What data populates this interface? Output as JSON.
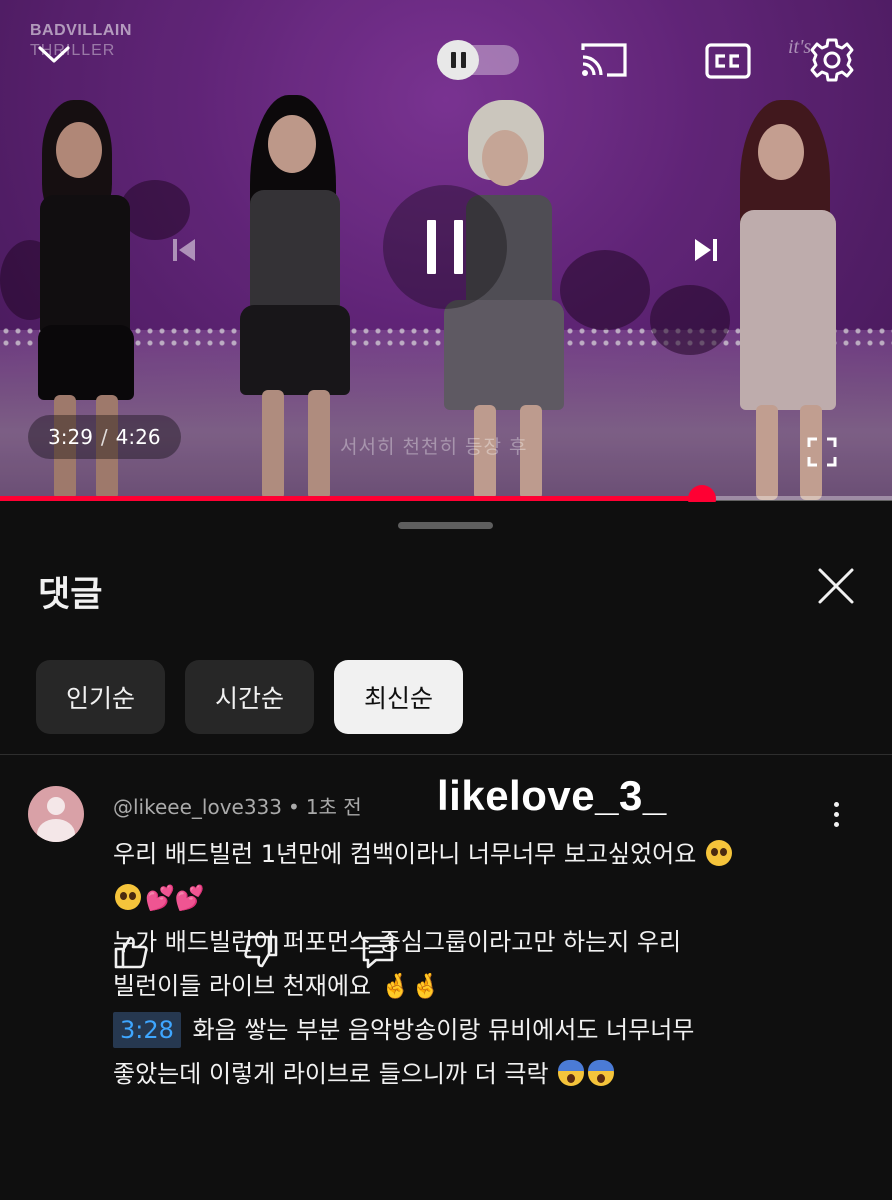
{
  "player": {
    "brand": "BADVILLAIN",
    "brand_sub": "THRILLER",
    "watermark": "it's",
    "current_time": "3:29",
    "separator": "/",
    "duration": "4:26",
    "subtitle": "서서히 천천히 등장 후",
    "progress_fraction": 0.787
  },
  "comments_panel": {
    "title": "댓글",
    "sort_chips": [
      {
        "label": "인기순",
        "active": false
      },
      {
        "label": "시간순",
        "active": false
      },
      {
        "label": "최신순",
        "active": true
      }
    ]
  },
  "comment": {
    "author": "@likeee_love333",
    "meta_dot": "•",
    "time_ago": "1초 전",
    "overlay_tag": "likelove_3_",
    "lines": {
      "l1": "우리 배드빌런 1년만에 컴백이라니 너무너무 보고싶었어요",
      "l3": "누가 배드빌런이 퍼포먼스 중심그룹이라고만 하는지 우리",
      "l4": "빌런이들 라이브 천재에요",
      "l5_timestamp": "3:28",
      "l5": "화음 쌓는 부분 음악방송이랑 뮤비에서도 너무너무",
      "l6": "좋았는데 이렇게 라이브로 들으니까 더 극락"
    },
    "emoji": {
      "hearts": "💕💕",
      "fingers": "🤞🤞"
    }
  },
  "icons": {
    "collapse": "chevron-down-icon",
    "cast": "cast-icon",
    "cc": "closed-captions-icon",
    "settings": "gear-icon",
    "fullscreen": "fullscreen-icon",
    "close": "close-icon",
    "more": "more-vert-icon",
    "like": "thumbs-up-icon",
    "dislike": "thumbs-down-icon",
    "reply": "reply-icon"
  },
  "colors": {
    "accent_red": "#ff0033",
    "link_blue": "#3ea6ff",
    "sheet_bg": "#0f0f0f"
  }
}
